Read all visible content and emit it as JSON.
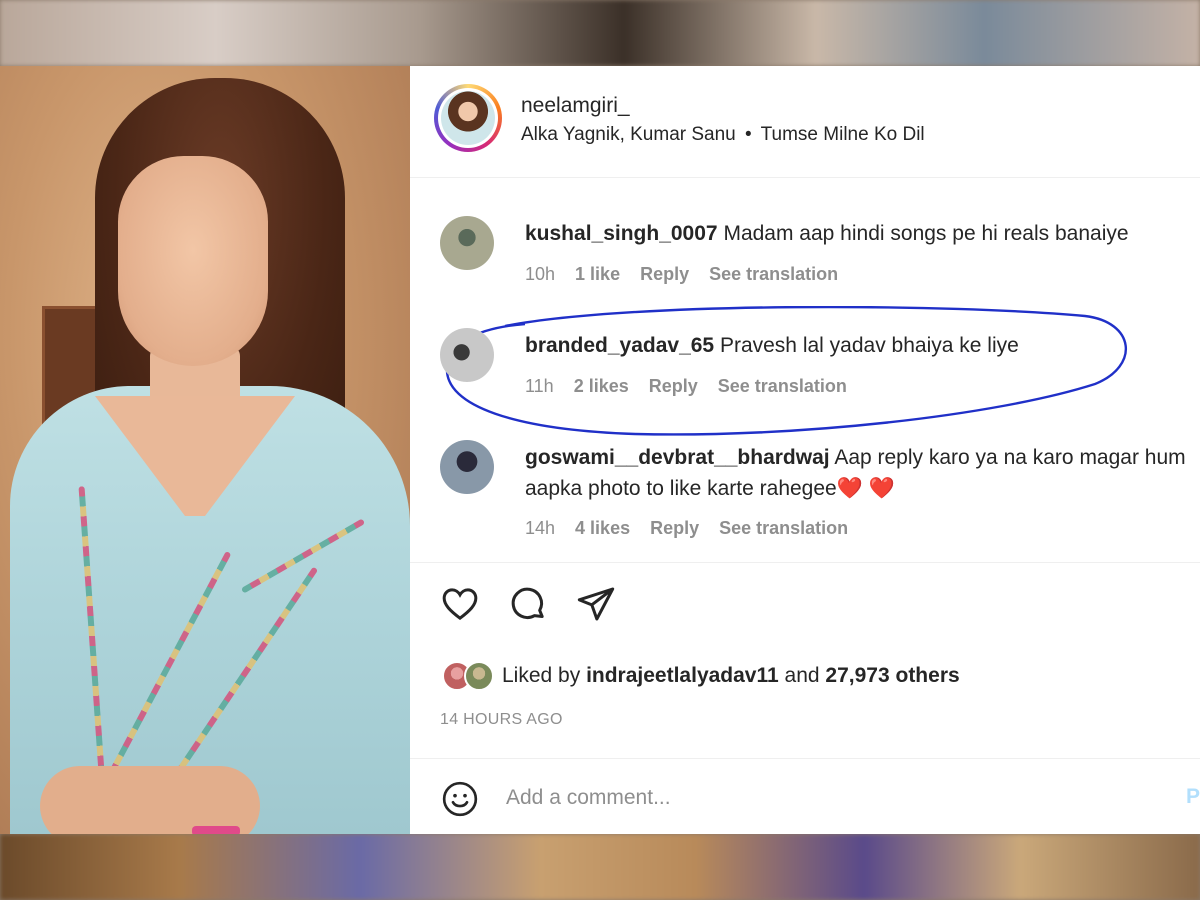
{
  "post": {
    "username": "neelamgiri_",
    "audio": "Alka Yagnik, Kumar Sanu",
    "separator": "•",
    "song": "Tumse Milne Ko Dil"
  },
  "comments": [
    {
      "user": "kushal_singh_0007",
      "text": "Madam aap hindi songs pe hi reals banaiye",
      "time": "10h",
      "likes": "1 like",
      "reply": "Reply",
      "translate": "See translation"
    },
    {
      "user": "branded_yadav_65",
      "text": "Pravesh lal yadav bhaiya ke liye",
      "time": "11h",
      "likes": "2 likes",
      "reply": "Reply",
      "translate": "See translation",
      "highlighted": true
    },
    {
      "user": "goswami__devbrat__bhardwaj",
      "text": "Aap reply karo ya na karo magar hum aapka photo to like karte rahegee",
      "emoji": "❤️ ❤️",
      "time": "14h",
      "likes": "4 likes",
      "reply": "Reply",
      "translate": "See translation"
    }
  ],
  "actions": {
    "like": "heart-icon",
    "comment": "comment-bubble-icon",
    "share": "paper-plane-icon"
  },
  "likes": {
    "prefix": "Liked by",
    "user": "indrajeetlalyadav11",
    "middle": "and",
    "others": "27,973 others"
  },
  "time_ago": "14 HOURS AGO",
  "composer": {
    "placeholder": "Add a comment...",
    "post_label": "P"
  },
  "colors": {
    "highlight_ink": "#2030c8",
    "heart": "#e0242c",
    "secondary_text": "#8e8e8e"
  }
}
